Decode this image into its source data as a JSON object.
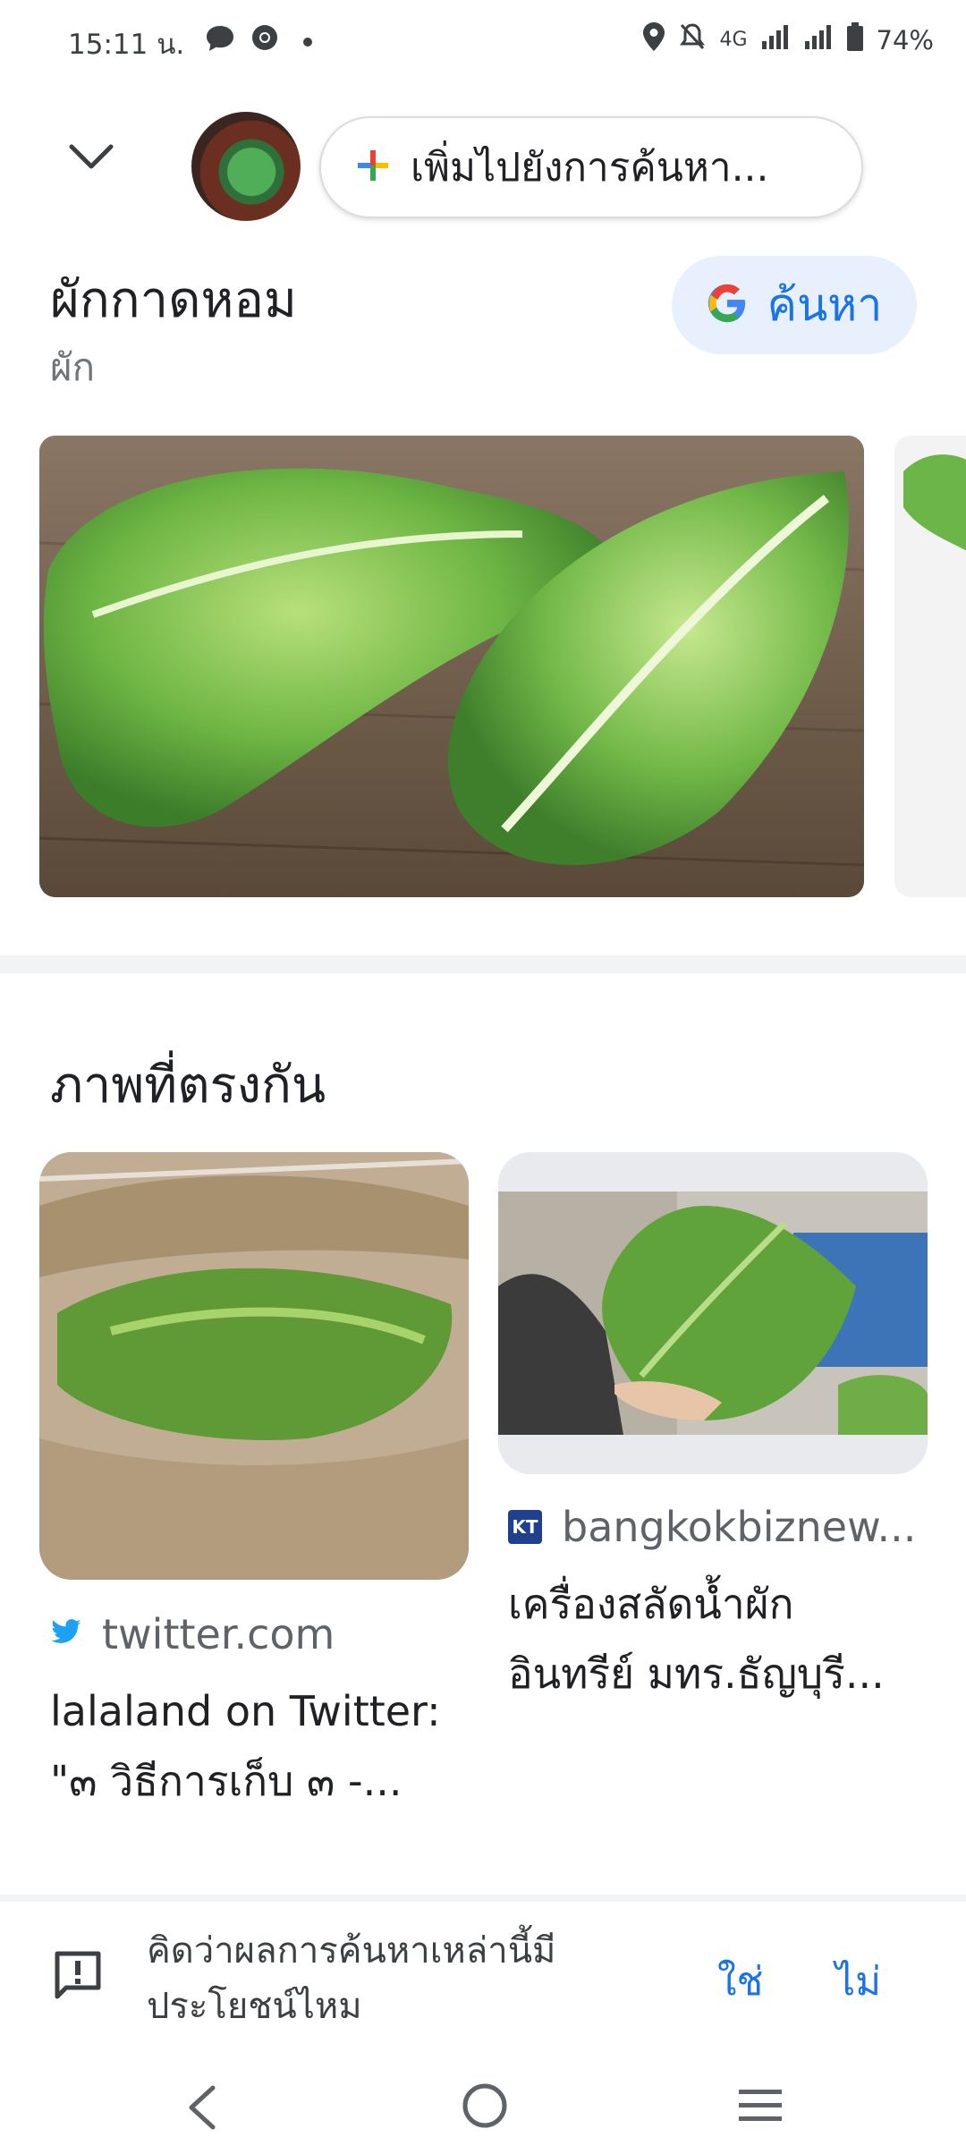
{
  "status_bar": {
    "time": "15:11 น.",
    "network": "4G",
    "battery": "74%"
  },
  "top_bar": {
    "add_to_search_label": "เพิ่มไปยังการค้นหา..."
  },
  "entity": {
    "title": "ผักกาดหอม",
    "subtitle": "ผัก",
    "search_label": "ค้นหา"
  },
  "matches": {
    "section_title": "ภาพที่ตรงกัน",
    "cards": [
      {
        "source": "twitter.com",
        "title_line1": "lalaland on Twitter:",
        "title_line2": "\"๓ วิธีการเก็บ ๓ -..."
      },
      {
        "source": "bangkokbiznew...",
        "source_badge": "KT",
        "title_line1": "เครื่องสลัดน้ำผัก",
        "title_line2": "อินทรีย์ มทร.ธัญบุรี..."
      }
    ]
  },
  "feedback": {
    "question": "คิดว่าผลการค้นหาเหล่านี้มีประโยชน์ไหม",
    "yes_label": "ใช่",
    "no_label": "ไม่"
  },
  "colors": {
    "accent": "#1a73e8",
    "chip_bg": "#e8f0fe",
    "divider": "#f1f3f4"
  },
  "icons": [
    "chevron-down-icon",
    "plus-icon",
    "google-g-icon",
    "twitter-icon",
    "feedback-icon",
    "back-icon",
    "home-icon",
    "recents-icon"
  ]
}
